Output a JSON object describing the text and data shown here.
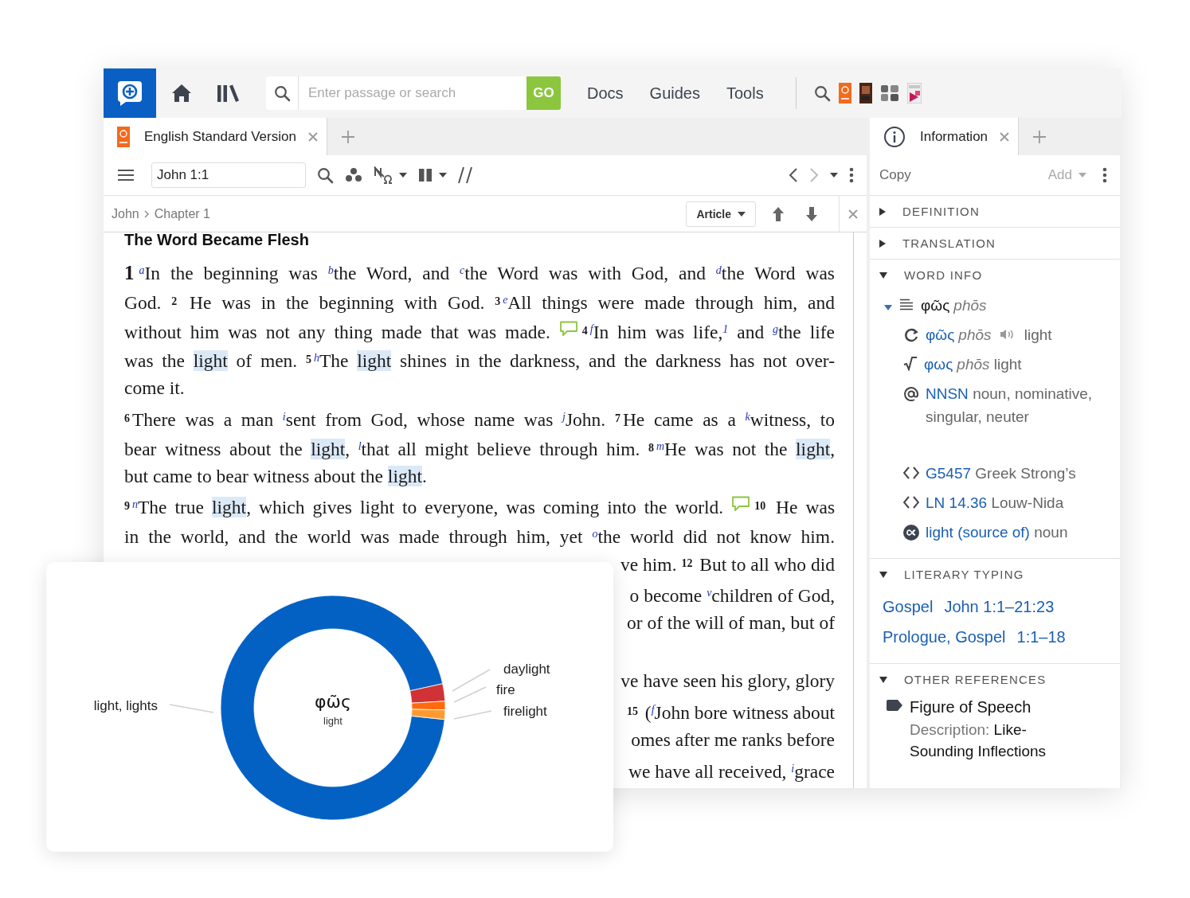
{
  "topbar": {
    "search": {
      "placeholder": "Enter passage or search",
      "button": "GO"
    },
    "links": [
      {
        "label": "Docs"
      },
      {
        "label": "Guides"
      },
      {
        "label": "Tools"
      }
    ]
  },
  "left_pane": {
    "tab": {
      "title": "English Standard Version",
      "selected": true
    },
    "reference": "John 1:1",
    "breadcrumb": [
      "John",
      "Chapter 1"
    ],
    "view_button": "Article",
    "heading": "The Word Became Flesh",
    "lines": [
      {
        "kind": "justified",
        "segments": [
          {
            "kind": "chapter",
            "text": "1"
          },
          {
            "kind": "xref",
            "text": "a"
          },
          {
            "kind": "text",
            "text": "In the beginning was "
          },
          {
            "kind": "xref",
            "text": "b"
          },
          {
            "kind": "text",
            "text": "the Word, and "
          },
          {
            "kind": "xref",
            "text": "c"
          },
          {
            "kind": "text",
            "text": "the Word was with God, and "
          },
          {
            "kind": "xref",
            "text": "d"
          },
          {
            "kind": "text",
            "text": "the Word was"
          }
        ]
      },
      {
        "kind": "justified",
        "segments": [
          {
            "kind": "text",
            "text": "God. "
          },
          {
            "kind": "verse",
            "text": "2"
          },
          {
            "kind": "text",
            "text": " He was in the beginning with God. "
          },
          {
            "kind": "verse",
            "text": "3"
          },
          {
            "kind": "xref",
            "text": "e"
          },
          {
            "kind": "text",
            "text": "All things were made through him, and"
          }
        ]
      },
      {
        "kind": "justified",
        "segments": [
          {
            "kind": "text",
            "text": "without him was not any thing made that was made. "
          },
          {
            "kind": "note"
          },
          {
            "kind": "verse",
            "text": "4"
          },
          {
            "kind": "xref",
            "text": "f"
          },
          {
            "kind": "text",
            "text": "In him was life,"
          },
          {
            "kind": "footnote",
            "text": "1"
          },
          {
            "kind": "text",
            "text": " and "
          },
          {
            "kind": "xref",
            "text": "g"
          },
          {
            "kind": "text",
            "text": "the life"
          }
        ]
      },
      {
        "kind": "justified",
        "segments": [
          {
            "kind": "text",
            "text": "was the "
          },
          {
            "kind": "highlight",
            "text": "light"
          },
          {
            "kind": "text",
            "text": " of men. "
          },
          {
            "kind": "verse",
            "text": "5"
          },
          {
            "kind": "xref",
            "text": "h"
          },
          {
            "kind": "text",
            "text": "The "
          },
          {
            "kind": "highlight",
            "text": "light"
          },
          {
            "kind": "text",
            "text": " shines in the darkness, and the darkness has not over-"
          }
        ]
      },
      {
        "kind": "paragraph-end",
        "segments": [
          {
            "kind": "text",
            "text": "come it."
          }
        ]
      },
      {
        "kind": "justified",
        "segments": [
          {
            "kind": "verse",
            "text": "6"
          },
          {
            "kind": "text",
            "text": "There was a man "
          },
          {
            "kind": "xref",
            "text": "i"
          },
          {
            "kind": "text",
            "text": "sent from God, whose name was "
          },
          {
            "kind": "xref",
            "text": "j"
          },
          {
            "kind": "text",
            "text": "John. "
          },
          {
            "kind": "verse",
            "text": "7"
          },
          {
            "kind": "text",
            "text": "He came as a "
          },
          {
            "kind": "xref",
            "text": "k"
          },
          {
            "kind": "text",
            "text": "witness, to"
          }
        ]
      },
      {
        "kind": "justified",
        "segments": [
          {
            "kind": "text",
            "text": "bear witness about the "
          },
          {
            "kind": "highlight",
            "text": "light"
          },
          {
            "kind": "text",
            "text": ", "
          },
          {
            "kind": "xref",
            "text": "l"
          },
          {
            "kind": "text",
            "text": "that all might believe through him. "
          },
          {
            "kind": "verse",
            "text": "8"
          },
          {
            "kind": "xref",
            "text": "m"
          },
          {
            "kind": "text",
            "text": "He was not the "
          },
          {
            "kind": "highlight",
            "text": "light"
          },
          {
            "kind": "text",
            "text": ","
          }
        ]
      },
      {
        "kind": "paragraph-end",
        "segments": [
          {
            "kind": "text",
            "text": "but came to bear witness about the "
          },
          {
            "kind": "highlight",
            "text": "light"
          },
          {
            "kind": "text",
            "text": "."
          }
        ]
      },
      {
        "kind": "justified",
        "segments": [
          {
            "kind": "verse",
            "text": "9"
          },
          {
            "kind": "xref",
            "text": "n"
          },
          {
            "kind": "text",
            "text": "The true "
          },
          {
            "kind": "highlight",
            "text": "light"
          },
          {
            "kind": "text",
            "text": ", which gives light to everyone, was coming into the world. "
          },
          {
            "kind": "note"
          },
          {
            "kind": "verse",
            "text": "10"
          },
          {
            "kind": "text",
            "text": " He was"
          }
        ]
      },
      {
        "kind": "justified",
        "segments": [
          {
            "kind": "text",
            "text": "in the world, and the world was made through him, yet "
          },
          {
            "kind": "xref",
            "text": "o"
          },
          {
            "kind": "text",
            "text": "the world did not know him."
          }
        ]
      },
      {
        "kind": "covered",
        "segments": [
          {
            "kind": "text",
            "text": "ve him. "
          },
          {
            "kind": "verse",
            "text": "12"
          },
          {
            "kind": "text",
            "text": " But to all who did"
          }
        ]
      },
      {
        "kind": "covered",
        "segments": [
          {
            "kind": "text",
            "text": "o become "
          },
          {
            "kind": "xref",
            "text": "v"
          },
          {
            "kind": "text",
            "text": "children of God,"
          }
        ]
      },
      {
        "kind": "covered",
        "segments": [
          {
            "kind": "text",
            "text": "or of the will of man, but of"
          }
        ]
      },
      {
        "kind": "gap"
      },
      {
        "kind": "covered",
        "segments": [
          {
            "kind": "text",
            "text": "ve have seen his glory, glory"
          }
        ]
      },
      {
        "kind": "covered",
        "segments": [
          {
            "kind": "verse",
            "text": "15"
          },
          {
            "kind": "text",
            "text": " ("
          },
          {
            "kind": "xref",
            "text": "f"
          },
          {
            "kind": "text",
            "text": "John bore witness about"
          }
        ]
      },
      {
        "kind": "covered",
        "segments": [
          {
            "kind": "text",
            "text": "omes after me ranks before"
          }
        ]
      },
      {
        "kind": "covered",
        "segments": [
          {
            "kind": "text",
            "text": "we have all received, "
          },
          {
            "kind": "xref",
            "text": "i"
          },
          {
            "kind": "text",
            "text": "grace"
          }
        ]
      }
    ]
  },
  "right_pane": {
    "tab": {
      "title": "Information",
      "selected": true
    },
    "actions": [
      {
        "label": "Copy",
        "disabled": false
      },
      {
        "label": "Add",
        "disabled": true
      }
    ],
    "sections": [
      {
        "title": "DEFINITION",
        "expanded": false
      },
      {
        "title": "TRANSLATION",
        "expanded": false
      },
      {
        "kind": "word-info",
        "title": "WORD INFO",
        "expanded": true,
        "headword": {
          "lemma": "φῶς",
          "translit": "phōs",
          "expanded": true
        },
        "rows": [
          {
            "kind": "lemma",
            "link": "φῶς",
            "translit": "phōs",
            "audio": true,
            "gloss": "light"
          },
          {
            "kind": "root",
            "link": "φως",
            "translit": "phōs",
            "audio": false,
            "gloss": "light"
          },
          {
            "kind": "morphology",
            "link": "NNSN",
            "gloss": "noun, nominative, singular, neuter"
          },
          {
            "kind": "strongs",
            "link": "G5457",
            "gloss": "Greek Strong’s"
          },
          {
            "kind": "louw-nida",
            "link": "LN 14.36",
            "gloss": "Louw-Nida"
          },
          {
            "kind": "sense",
            "link": "light (source of)",
            "gloss": "noun"
          }
        ]
      },
      {
        "kind": "literary",
        "title": "LITERARY TYPING",
        "expanded": true,
        "items": [
          {
            "label": "Gospel",
            "reference": "John 1:1–21:23"
          },
          {
            "label": "Prologue, Gospel",
            "reference": "1:1–18"
          }
        ]
      },
      {
        "kind": "references",
        "title": "OTHER REFERENCES",
        "expanded": true,
        "items": [
          {
            "title": "Figure of Speech",
            "description_label": "Description:",
            "description": "Like-Sounding Inflections"
          }
        ]
      }
    ]
  },
  "chart_card": {
    "center_word": "φῶς",
    "center_gloss": "light",
    "chart_data": {
      "type": "donut",
      "categories": [
        "light, lights",
        "daylight",
        "fire",
        "firelight"
      ],
      "values": [
        94.9,
        2.5,
        1.25,
        1.35
      ],
      "colors": [
        "#0461c4",
        "#d03236",
        "#ff6a0d",
        "#ff9a33"
      ]
    }
  }
}
